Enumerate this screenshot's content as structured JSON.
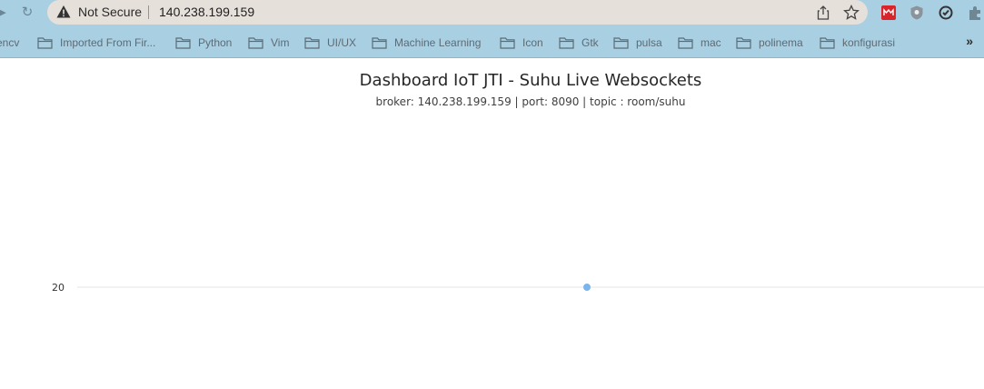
{
  "browser": {
    "security_label": "Not Secure",
    "url": "140.238.199.159",
    "icons": [
      "back-icon",
      "reload-icon",
      "warning-icon",
      "share-icon",
      "star-icon",
      "extension-icon",
      "shield-icon",
      "refresh-extension-icon",
      "puzzle-icon"
    ]
  },
  "bookmarks": [
    {
      "label": "encv"
    },
    {
      "label": "Imported From Fir..."
    },
    {
      "label": "Python"
    },
    {
      "label": "Vim"
    },
    {
      "label": "UI/UX"
    },
    {
      "label": "Machine Learning"
    },
    {
      "label": "Icon"
    },
    {
      "label": "Gtk"
    },
    {
      "label": "pulsa"
    },
    {
      "label": "mac"
    },
    {
      "label": "polinema"
    },
    {
      "label": "konfigurasi"
    }
  ],
  "bookmarks_overflow": "»",
  "page": {
    "title": "Dashboard IoT JTI - Suhu Live Websockets",
    "subtitle": "broker: 140.238.199.159 | port: 8090 | topic : room/suhu"
  },
  "chart_data": {
    "type": "line",
    "title": "",
    "xlabel": "",
    "ylabel": "",
    "y_ticks": [
      "20"
    ],
    "series": [
      {
        "x": [
          0
        ],
        "y": [
          20
        ]
      }
    ],
    "point_color": "#7cb5ec",
    "gridline_color": "#e6e6e6"
  }
}
